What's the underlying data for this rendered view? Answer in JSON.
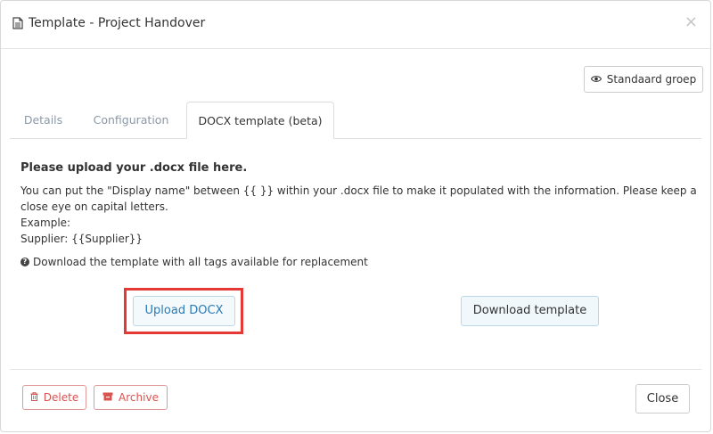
{
  "header": {
    "title": "Template - Project Handover",
    "title_icon": "file-text-icon",
    "close_symbol": "×"
  },
  "toolbar": {
    "standard_group_label": "Standaard groep",
    "standard_group_icon": "eye-icon"
  },
  "tabs": [
    {
      "label": "Details",
      "active": false
    },
    {
      "label": "Configuration",
      "active": false
    },
    {
      "label": "DOCX template (beta)",
      "active": true
    }
  ],
  "content": {
    "heading": "Please upload your .docx file here.",
    "description": "You can put the \"Display name\" between {{ }} within your .docx file to make it populated with the information. Please keep a close eye on capital letters.",
    "example_label": "Example:",
    "example_value": "Supplier: {{Supplier}}",
    "help_text": "Download the template with all tags available for replacement",
    "help_icon": "question-circle-icon"
  },
  "actions": {
    "upload_label": "Upload DOCX",
    "download_label": "Download template"
  },
  "footer": {
    "delete_label": "Delete",
    "archive_label": "Archive",
    "close_label": "Close"
  },
  "colors": {
    "highlight": "#e53935",
    "danger": "#d9534f",
    "link": "#2a7ab5"
  }
}
